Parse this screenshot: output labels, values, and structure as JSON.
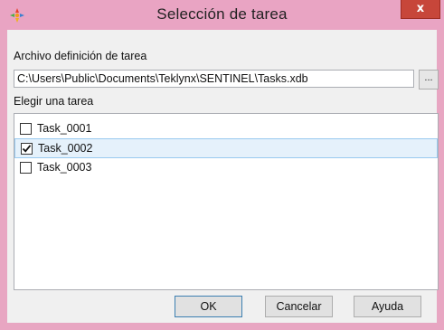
{
  "window": {
    "title": "Selección de tarea",
    "close_glyph": "x"
  },
  "file_section": {
    "label": "Archivo definición de tarea",
    "path_value": "C:\\Users\\Public\\Documents\\Teklynx\\SENTINEL\\Tasks.xdb",
    "browse_label": "..."
  },
  "task_section": {
    "label": "Elegir una tarea",
    "tasks": [
      {
        "label": "Task_0001",
        "checked": false
      },
      {
        "label": "Task_0002",
        "checked": true
      },
      {
        "label": "Task_0003",
        "checked": false
      }
    ]
  },
  "buttons": {
    "ok_label": "OK",
    "cancel_label": "Cancelar",
    "help_label": "Ayuda"
  },
  "colors": {
    "titlebar": "#e9a4c3",
    "close": "#c7463a",
    "selection": "#e5f1fb"
  },
  "icons": {
    "app": "sentinel-app-icon",
    "close": "close-icon",
    "check": "checkmark-icon"
  }
}
